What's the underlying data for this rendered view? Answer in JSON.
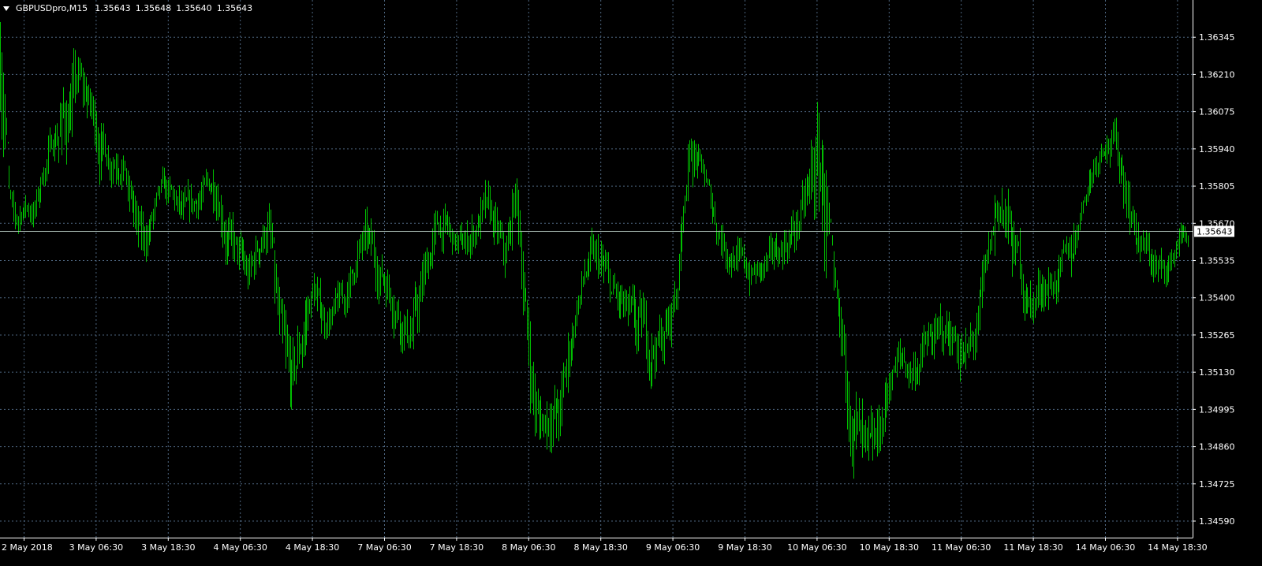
{
  "header": {
    "symbol": "GBPUSDpro,M15",
    "open": "1.35643",
    "high": "1.35648",
    "low": "1.35640",
    "close": "1.35643"
  },
  "colors": {
    "background": "#000000",
    "grid": "#4e6680",
    "bars": "#00c000",
    "axis": "#ffffff",
    "current_price_line": "#a6b8b0"
  },
  "icons": {
    "dropdown": "triangle-down-icon"
  },
  "chart_data": {
    "type": "bar",
    "style": "ohlc-bars",
    "symbol": "GBPUSDpro",
    "timeframe": "M15",
    "current_price": 1.35643,
    "current_price_label": "1.35643",
    "ylim": [
      1.3453,
      1.3648
    ],
    "y_ticks": [
      1.3459,
      1.34725,
      1.3486,
      1.34995,
      1.3513,
      1.35265,
      1.354,
      1.35535,
      1.3567,
      1.35805,
      1.3594,
      1.36075,
      1.3621,
      1.36345
    ],
    "y_tick_labels": [
      "1.34590",
      "1.34725",
      "1.34860",
      "1.34995",
      "1.35130",
      "1.35265",
      "1.35400",
      "1.35535",
      "1.35670",
      "1.35805",
      "1.35940",
      "1.36075",
      "1.36210",
      "1.36345"
    ],
    "x_tick_labels": [
      "2 May 2018",
      "3 May 06:30",
      "3 May 18:30",
      "4 May 06:30",
      "4 May 18:30",
      "7 May 06:30",
      "7 May 18:30",
      "8 May 06:30",
      "8 May 18:30",
      "9 May 06:30",
      "9 May 18:30",
      "10 May 06:30",
      "10 May 18:30",
      "11 May 06:30",
      "11 May 18:30",
      "14 May 06:30",
      "14 May 18:30"
    ],
    "bars_per_tick": 48,
    "grid": true,
    "close_path": [
      1.363,
      1.356,
      1.3575,
      1.357,
      1.359,
      1.36,
      1.3605,
      1.362,
      1.3612,
      1.3598,
      1.359,
      1.3592,
      1.3578,
      1.3555,
      1.357,
      1.358,
      1.3575,
      1.3568,
      1.3575,
      1.358,
      1.3582,
      1.356,
      1.3555,
      1.3545,
      1.3562,
      1.3568,
      1.3515,
      1.3505,
      1.3528,
      1.3545,
      1.353,
      1.3535,
      1.354,
      1.3555,
      1.3562,
      1.355,
      1.3545,
      1.3535,
      1.3525,
      1.354,
      1.356,
      1.3568,
      1.356,
      1.3558,
      1.3565,
      1.3572,
      1.3565,
      1.355,
      1.3585,
      1.352,
      1.349,
      1.35,
      1.3495,
      1.3525,
      1.3545,
      1.3555,
      1.355,
      1.354,
      1.3535,
      1.3528,
      1.3525,
      1.3522,
      1.3528,
      1.3545,
      1.3595,
      1.359,
      1.3575,
      1.3562,
      1.3555,
      1.3552,
      1.3548,
      1.355,
      1.3555,
      1.356,
      1.3565,
      1.3575,
      1.359,
      1.3575,
      1.3525,
      1.3505,
      1.3485,
      1.3475,
      1.3495,
      1.3515,
      1.3518,
      1.3512,
      1.3522,
      1.3525,
      1.3528,
      1.3525,
      1.3515,
      1.353,
      1.3555,
      1.358,
      1.356,
      1.355,
      1.3535,
      1.3545,
      1.3545,
      1.355,
      1.356,
      1.358,
      1.359,
      1.36,
      1.3592,
      1.3578,
      1.3558,
      1.3555,
      1.3548,
      1.3552,
      1.3565,
      1.356
    ],
    "high_path": [
      1.364,
      1.3578,
      1.3582,
      1.358,
      1.36,
      1.361,
      1.363,
      1.3632,
      1.362,
      1.361,
      1.36,
      1.3598,
      1.3585,
      1.3572,
      1.358,
      1.3588,
      1.3585,
      1.3582,
      1.3588,
      1.3588,
      1.3588,
      1.3575,
      1.357,
      1.3562,
      1.3578,
      1.358,
      1.3545,
      1.353,
      1.355,
      1.356,
      1.3545,
      1.355,
      1.3558,
      1.3568,
      1.3575,
      1.3565,
      1.356,
      1.355,
      1.3545,
      1.356,
      1.358,
      1.3582,
      1.3572,
      1.357,
      1.3578,
      1.3588,
      1.3578,
      1.3565,
      1.3598,
      1.3545,
      1.352,
      1.3522,
      1.352,
      1.3545,
      1.356,
      1.357,
      1.3565,
      1.3555,
      1.355,
      1.3545,
      1.3542,
      1.354,
      1.3545,
      1.3565,
      1.361,
      1.3598,
      1.3585,
      1.3572,
      1.3565,
      1.3562,
      1.356,
      1.3562,
      1.3565,
      1.3575,
      1.358,
      1.359,
      1.3618,
      1.359,
      1.3548,
      1.3525,
      1.3508,
      1.3498,
      1.3518,
      1.353,
      1.3532,
      1.3528,
      1.3535,
      1.354,
      1.3545,
      1.354,
      1.3532,
      1.3548,
      1.357,
      1.3598,
      1.358,
      1.357,
      1.355,
      1.356,
      1.356,
      1.3565,
      1.3575,
      1.359,
      1.36,
      1.3605,
      1.3608,
      1.3595,
      1.3575,
      1.3568,
      1.3562,
      1.3562,
      1.357,
      1.3568
    ],
    "low_path": [
      1.355,
      1.3552,
      1.3565,
      1.3562,
      1.3578,
      1.359,
      1.358,
      1.3595,
      1.3588,
      1.357,
      1.3575,
      1.3575,
      1.354,
      1.3538,
      1.356,
      1.3568,
      1.3565,
      1.356,
      1.3565,
      1.357,
      1.356,
      1.3545,
      1.3542,
      1.3535,
      1.3548,
      1.355,
      1.3488,
      1.349,
      1.351,
      1.353,
      1.3522,
      1.3528,
      1.353,
      1.3542,
      1.3548,
      1.3538,
      1.353,
      1.352,
      1.3512,
      1.3525,
      1.3548,
      1.3555,
      1.355,
      1.3548,
      1.3555,
      1.356,
      1.355,
      1.3538,
      1.356,
      1.3495,
      1.3482,
      1.3485,
      1.3482,
      1.3505,
      1.3535,
      1.3545,
      1.3538,
      1.3528,
      1.3522,
      1.3512,
      1.3495,
      1.351,
      1.3515,
      1.3525,
      1.3575,
      1.3575,
      1.356,
      1.3548,
      1.3542,
      1.354,
      1.3538,
      1.354,
      1.3545,
      1.355,
      1.3555,
      1.3562,
      1.356,
      1.35,
      1.349,
      1.3475,
      1.3462,
      1.3458,
      1.3478,
      1.3502,
      1.3508,
      1.3502,
      1.351,
      1.3515,
      1.3518,
      1.351,
      1.35,
      1.3518,
      1.3538,
      1.3558,
      1.354,
      1.3535,
      1.352,
      1.3535,
      1.3535,
      1.354,
      1.3545,
      1.357,
      1.358,
      1.3588,
      1.3578,
      1.356,
      1.3548,
      1.3545,
      1.354,
      1.3545,
      1.3555,
      1.3552
    ]
  }
}
